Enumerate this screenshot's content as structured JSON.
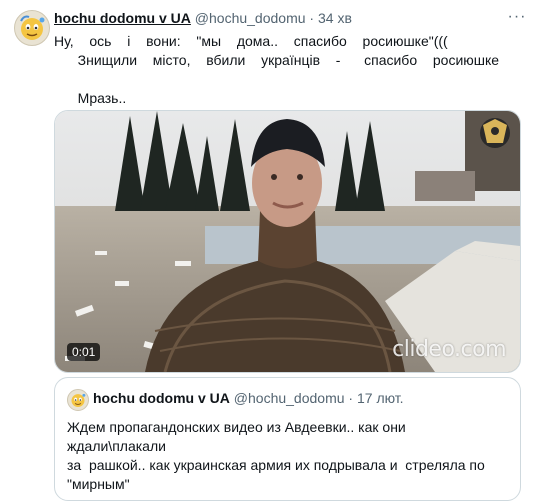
{
  "tweet": {
    "author_name": "hochu dodomu v UA",
    "handle": "@hochu_dodomu",
    "separator": "·",
    "time": "34 хв",
    "more_label": "···",
    "text": "Ну,  ось  і  вони:  \"мы  дома..  спасибо  росиюшке\"(((\n   Знищили  місто,  вбили  українців  -   спасибо  росиюшке\n\n   Мразь.."
  },
  "media": {
    "duration": "0:01",
    "watermark": "clideo.com"
  },
  "quote": {
    "author_name": "hochu dodomu v UA",
    "handle": "@hochu_dodomu",
    "separator": "·",
    "time": "17 лют.",
    "text": "Ждем пропагандонских видео из Авдеевки.. как они ждали\\плакали\nза  рашкой.. как украинская армия их подрывала и  стреляла по\n\"мирным\""
  }
}
